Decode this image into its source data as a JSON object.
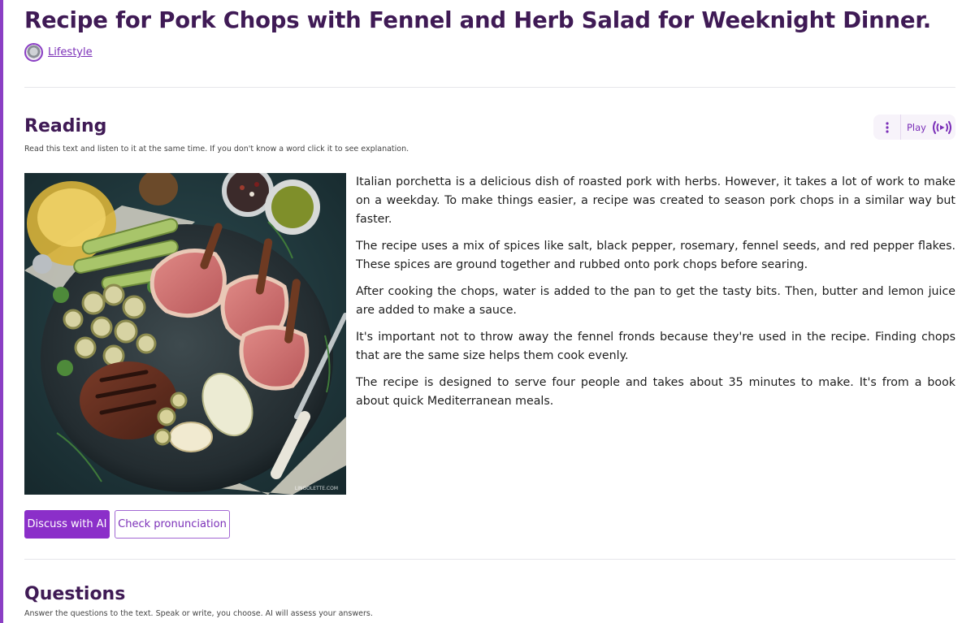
{
  "header": {
    "title": "Recipe for Pork Chops with Fennel and Herb Salad for Weeknight Dinner.",
    "category": "Lifestyle"
  },
  "reading": {
    "title": "Reading",
    "subtitle": "Read this text and listen to it at the same time. If you don't know a word click it to see explanation.",
    "play_label": "Play",
    "image_watermark": "LINGOLETTE.COM",
    "paragraphs": [
      "Italian porchetta is a delicious dish of roasted pork with herbs. However, it takes a lot of work to make on a weekday. To make things easier, a recipe was created to season pork chops in a similar way but faster.",
      "The recipe uses a mix of spices like salt, black pepper, rosemary, fennel seeds, and red pepper flakes. These spices are ground together and rubbed onto pork chops before searing.",
      "After cooking the chops, water is added to the pan to get the tasty bits. Then, butter and lemon juice are added to make a sauce.",
      "It's important not to throw away the fennel fronds because they're used in the recipe. Finding chops that are the same size helps them cook evenly.",
      "The recipe is designed to serve four people and takes about 35 minutes to make. It's from a book about quick Mediterranean meals."
    ],
    "discuss_button": "Discuss with AI",
    "pronunciation_button": "Check pronunciation"
  },
  "questions": {
    "title": "Questions",
    "subtitle": "Answer the questions to the text. Speak or write, you choose. AI will assess your answers."
  },
  "colors": {
    "accent": "#8b2fc9",
    "heading": "#3f1a55",
    "link": "#7b2fb8"
  },
  "icons": {
    "category": "lifestyle-avatar-icon",
    "menu": "kebab-menu-icon",
    "play": "play-broadcast-icon"
  }
}
